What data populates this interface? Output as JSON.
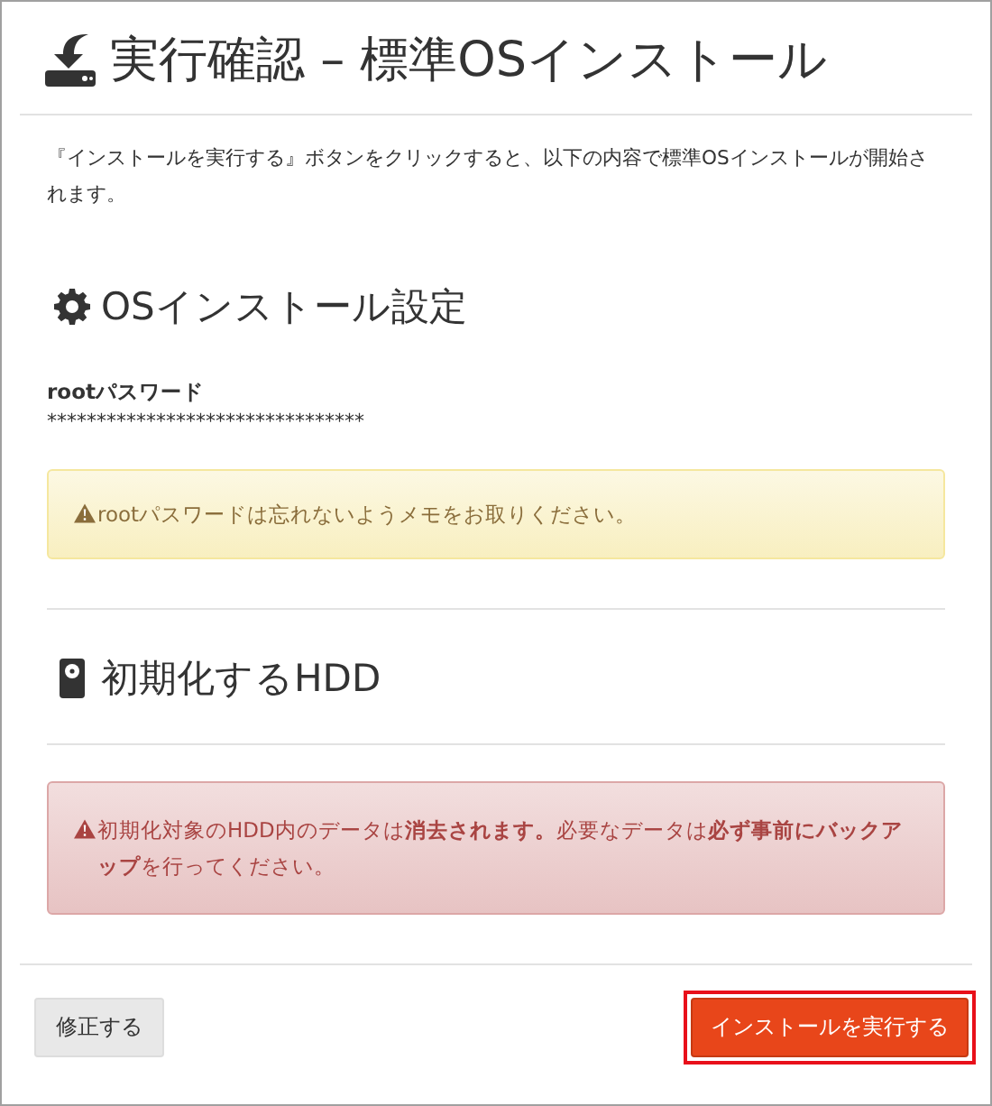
{
  "title": "実行確認 – 標準OSインストール",
  "intro": "『インストールを実行する』ボタンをクリックすると、以下の内容で標準OSインストールが開始されます。",
  "sections": [
    {
      "heading": "OSインストール設定",
      "fields": [
        {
          "label": "rootパスワード",
          "value": "********************************"
        }
      ],
      "alert": {
        "kind": "warning",
        "text": "rootパスワードは忘れないようメモをお取りください。"
      }
    },
    {
      "heading": "初期化するHDD",
      "alert": {
        "kind": "danger",
        "text": "初期化対象のHDD内のデータは**消去されます。**必要なデータは**必ず事前にバックアップ**を行ってください。"
      }
    }
  ],
  "buttons": [
    {
      "label": "修正する",
      "kind": "default",
      "highlighted": false
    },
    {
      "label": "インストールを実行する",
      "kind": "primary",
      "highlighted": true
    }
  ]
}
